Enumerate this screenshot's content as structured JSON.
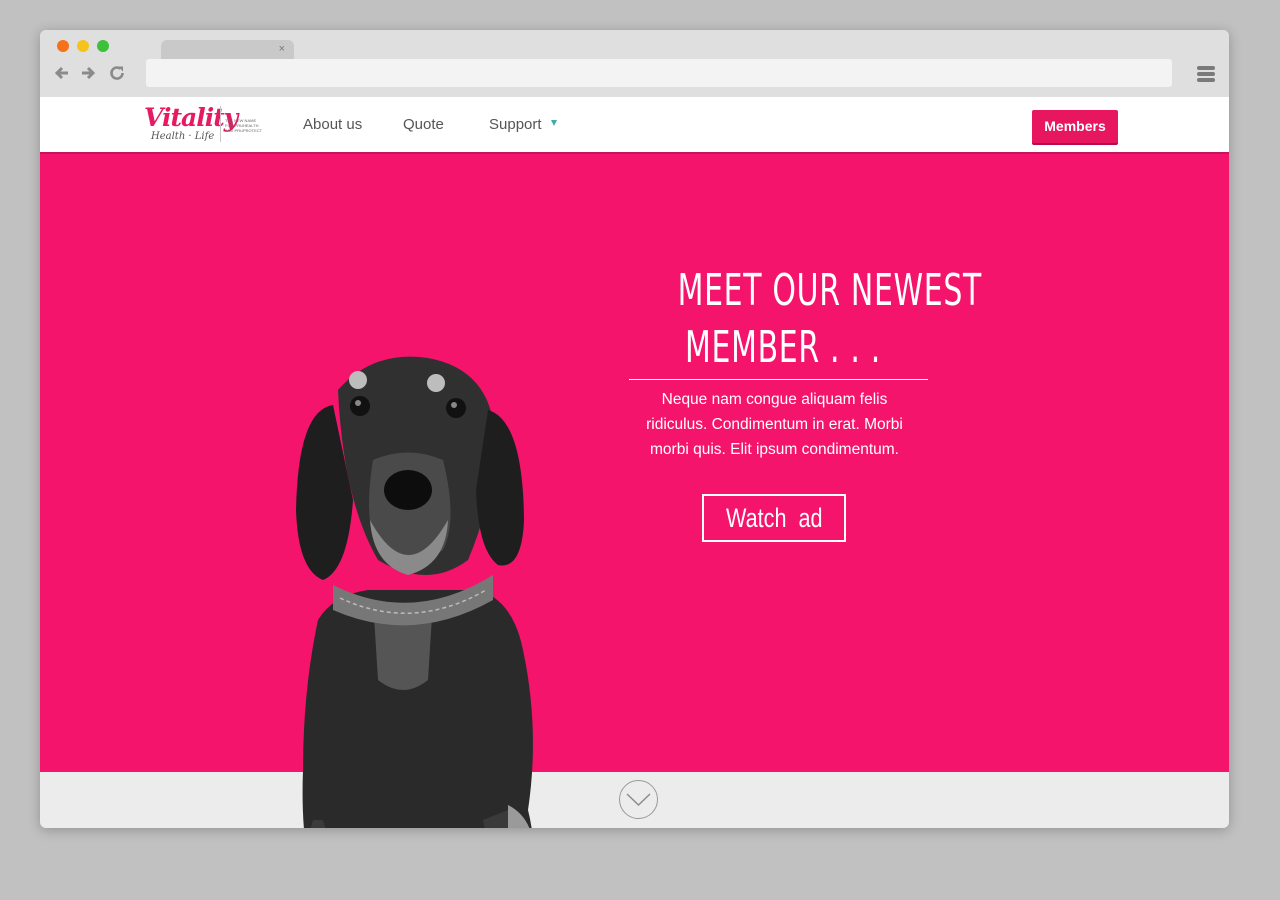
{
  "browser": {
    "tab_close": "×",
    "back_icon": "arrow-left-icon",
    "forward_icon": "arrow-right-icon",
    "reload_icon": "reload-icon",
    "menu_icon": "hamburger-menu-icon",
    "url": ""
  },
  "site": {
    "logo_main": "Vitality",
    "logo_sub": "Health · Life",
    "logo_tagline": "THE NEW NAME FOR PRUHEALTH AND PRUPROTECT",
    "nav": {
      "about": "About us",
      "quote": "Quote",
      "support": "Support",
      "members": "Members"
    }
  },
  "hero": {
    "title_line1": "MEET OUR NEWEST",
    "title_line2": "MEMBER . . .",
    "body": "Neque nam congue aliquam felis ridiculus. Condimentum in erat. Morbi morbi quis. Elit ipsum condimentum.",
    "cta": "Watch  ad"
  },
  "colors": {
    "brand_pink": "#f5146b",
    "button_pink": "#e8155f",
    "caret_teal": "#3aaea8"
  }
}
